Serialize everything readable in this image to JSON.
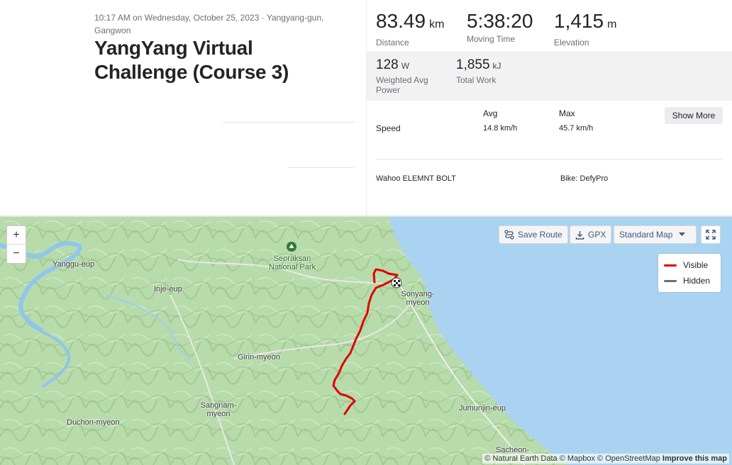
{
  "activity": {
    "datetime": "10:17 AM on Wednesday, October 25, 2023 · Yangyang-gun, Gangwon",
    "title": "YangYang Virtual Challenge (Course 3)"
  },
  "stats": {
    "distance": {
      "value": "83.49",
      "unit": "km",
      "label": "Distance"
    },
    "moving_time": {
      "value": "5:38:20",
      "label": "Moving Time"
    },
    "elevation": {
      "value": "1,415",
      "unit": "m",
      "label": "Elevation"
    },
    "power": {
      "value": "128",
      "unit": "W",
      "label": "Weighted Avg Power"
    },
    "work": {
      "value": "1,855",
      "unit": "kJ",
      "label": "Total Work"
    }
  },
  "speed_table": {
    "avg_header": "Avg",
    "max_header": "Max",
    "row_label": "Speed",
    "avg": "14.8 km/h",
    "max": "45.7 km/h",
    "show_more": "Show More"
  },
  "devices": {
    "device": "Wahoo ELEMNT BOLT",
    "bike": "Bike: DefyPro"
  },
  "map": {
    "zoom_in": "+",
    "zoom_out": "−",
    "save_route": "Save Route",
    "gpx": "GPX",
    "map_style": "Standard Map",
    "legend_visible": "Visible",
    "legend_hidden": "Hidden",
    "places": {
      "yanggu": "Yanggu-eup",
      "inje": "Inje-eup",
      "seorak": "Seoraksan National Park",
      "sonyang": "Sonyang-myeon",
      "girin": "Girin-myeon",
      "sangnam": "Sangnam-myeon",
      "duchon": "Duchon-myeon",
      "jumunjin": "Jumunjin-eup",
      "sacheon": "Sacheon-"
    },
    "attribution": {
      "text": "© Natural Earth Data © Mapbox © OpenStreetMap",
      "improve": "Improve this map"
    },
    "colors": {
      "route": "#e00000",
      "sea": "#a9d3f0",
      "land": "#b5d8a8",
      "hidden": "#6d6d78"
    }
  }
}
